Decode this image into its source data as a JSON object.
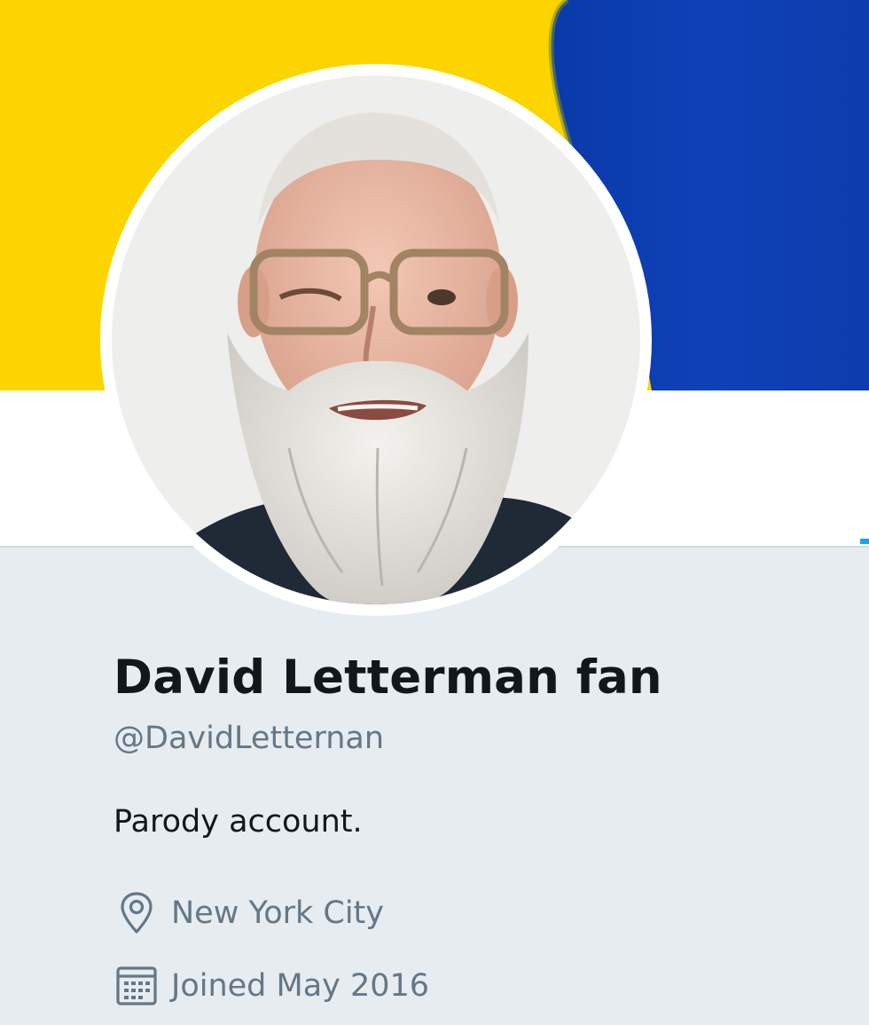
{
  "profile": {
    "display_name": "David Letterman fan",
    "handle": "@DavidLetternan",
    "bio": "Parody account.",
    "location": "New York City",
    "joined": "Joined May 2016"
  },
  "icons": {
    "location": "location-pin-icon",
    "joined": "calendar-icon"
  },
  "colors": {
    "banner_yellow": "#fcd500",
    "banner_blue": "#0d3fb6",
    "panel_background": "#e6ecf0",
    "name_text": "#14171a",
    "secondary_text": "#657786"
  }
}
